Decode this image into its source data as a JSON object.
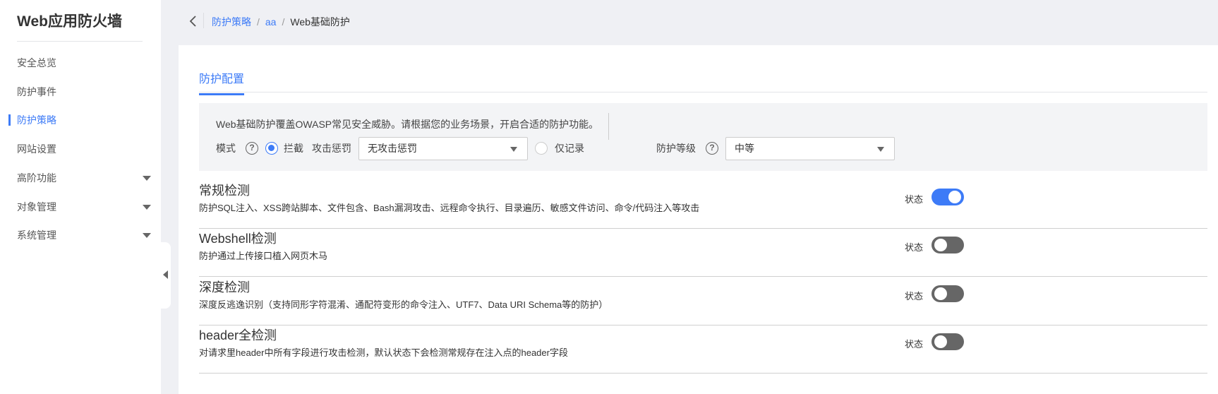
{
  "sidebar": {
    "title": "Web应用防火墙",
    "items": [
      {
        "label": "安全总览",
        "active": false,
        "expandable": false
      },
      {
        "label": "防护事件",
        "active": false,
        "expandable": false
      },
      {
        "label": "防护策略",
        "active": true,
        "expandable": false
      },
      {
        "label": "网站设置",
        "active": false,
        "expandable": false
      },
      {
        "label": "高阶功能",
        "active": false,
        "expandable": true
      },
      {
        "label": "对象管理",
        "active": false,
        "expandable": true
      },
      {
        "label": "系统管理",
        "active": false,
        "expandable": true
      }
    ]
  },
  "breadcrumb": {
    "items": [
      "防护策略",
      "aa",
      "Web基础防护"
    ],
    "separator": "/"
  },
  "tab": {
    "label": "防护配置"
  },
  "config": {
    "description": "Web基础防护覆盖OWASP常见安全威胁。请根据您的业务场景，开启合适的防护功能。",
    "mode_label": "模式",
    "block_label": "拦截",
    "penalty_label": "攻击惩罚",
    "penalty_value": "无攻击惩罚",
    "log_only_label": "仅记录",
    "level_label": "防护等级",
    "level_value": "中等"
  },
  "sections": [
    {
      "title": "常规检测",
      "desc": "防护SQL注入、XSS跨站脚本、文件包含、Bash漏洞攻击、远程命令执行、目录遍历、敏感文件访问、命令/代码注入等攻击",
      "state_label": "状态",
      "enabled": true
    },
    {
      "title": "Webshell检测",
      "desc": "防护通过上传接口植入网页木马",
      "state_label": "状态",
      "enabled": false
    },
    {
      "title": "深度检测",
      "desc": "深度反逃逸识别（支持同形字符混淆、通配符变形的命令注入、UTF7、Data URI Schema等的防护）",
      "state_label": "状态",
      "enabled": false
    },
    {
      "title": "header全检测",
      "desc": "对请求里header中所有字段进行攻击检测，默认状态下会检测常规存在注入点的header字段",
      "state_label": "状态",
      "enabled": false
    }
  ],
  "colors": {
    "accent": "#3d7bf7",
    "toggle_off": "#666666"
  }
}
